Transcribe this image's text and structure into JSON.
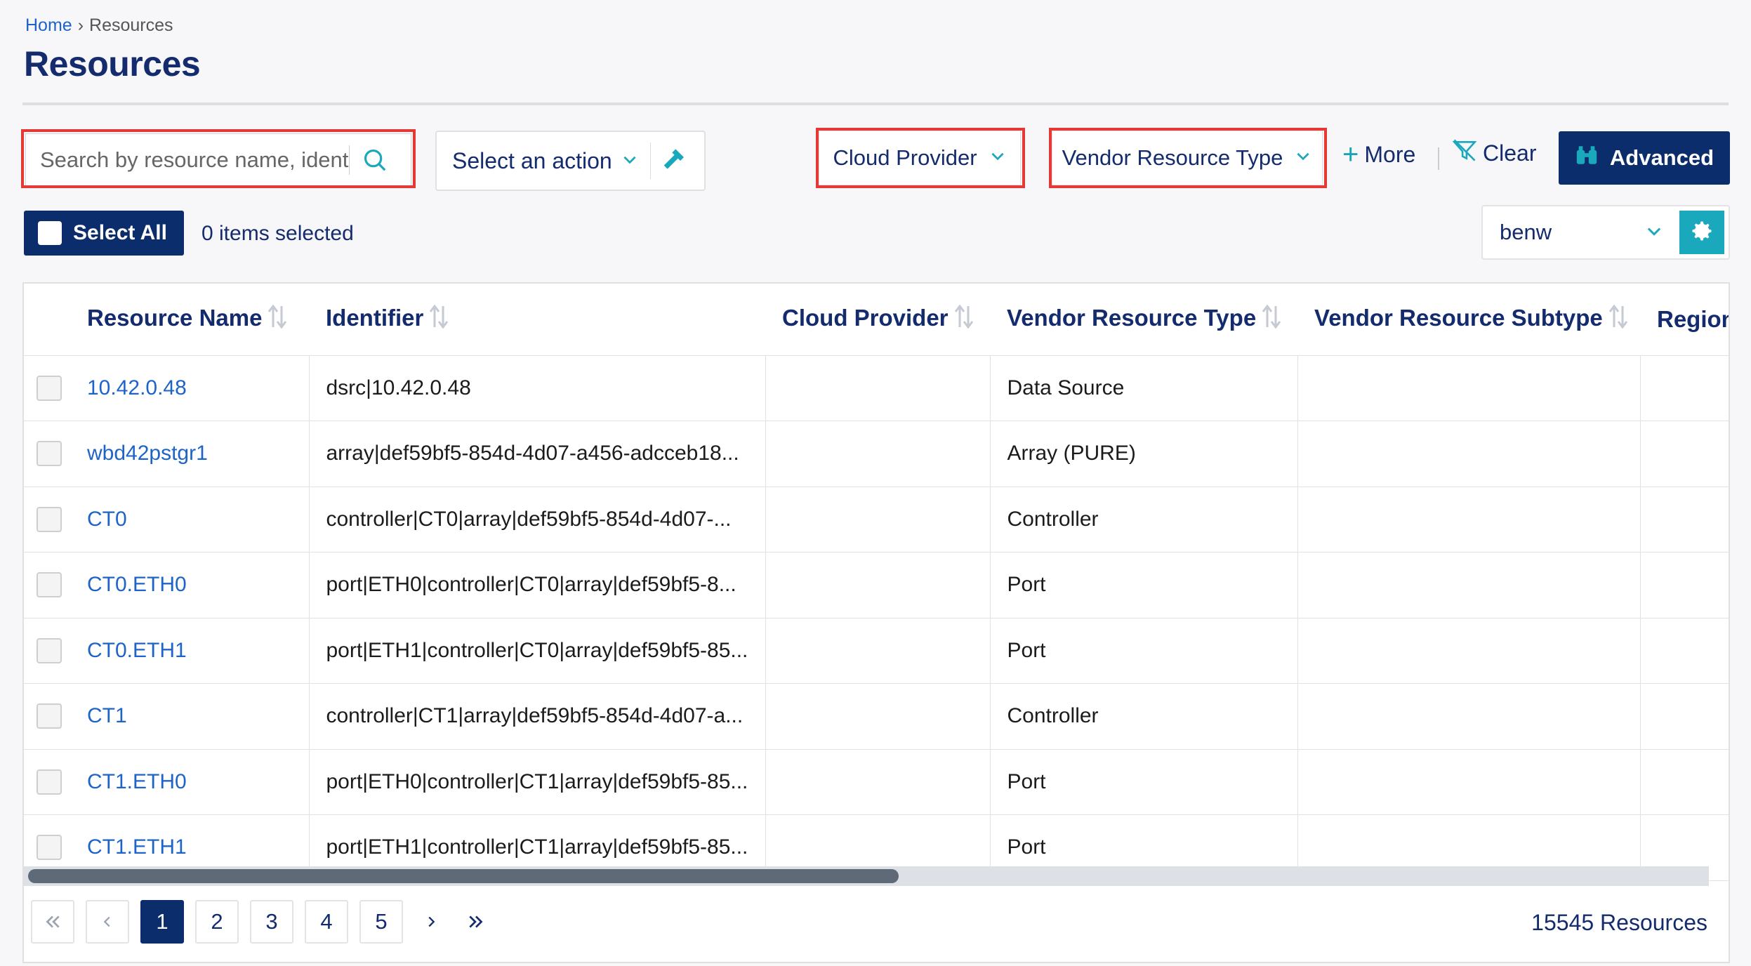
{
  "breadcrumb": {
    "home": "Home",
    "separator": "›",
    "current": "Resources"
  },
  "page": {
    "title": "Resources"
  },
  "toolbar": {
    "search_placeholder": "Search by resource name, identi",
    "action_label": "Select an action",
    "cloud_provider_label": "Cloud Provider",
    "vendor_resource_type_label": "Vendor Resource Type",
    "more_label": "More",
    "clear_label": "Clear",
    "advanced_label": "Advanced",
    "select_all_label": "Select All",
    "items_selected": "0 items selected",
    "user_select_value": "benw"
  },
  "table": {
    "columns": [
      "Resource Name",
      "Identifier",
      "Cloud Provider",
      "Vendor Resource Type",
      "Vendor Resource Subtype",
      "Region"
    ],
    "rows": [
      {
        "name": "10.42.0.48",
        "identifier": "dsrc|10.42.0.48",
        "cloud_provider": "",
        "vendor_type": "Data Source",
        "vendor_subtype": "",
        "region": ""
      },
      {
        "name": "wbd42pstgr1",
        "identifier": "array|def59bf5-854d-4d07-a456-adcceb18...",
        "cloud_provider": "",
        "vendor_type": "Array (PURE)",
        "vendor_subtype": "",
        "region": ""
      },
      {
        "name": "CT0",
        "identifier": "controller|CT0|array|def59bf5-854d-4d07-...",
        "cloud_provider": "",
        "vendor_type": "Controller",
        "vendor_subtype": "",
        "region": ""
      },
      {
        "name": "CT0.ETH0",
        "identifier": "port|ETH0|controller|CT0|array|def59bf5-8...",
        "cloud_provider": "",
        "vendor_type": "Port",
        "vendor_subtype": "",
        "region": ""
      },
      {
        "name": "CT0.ETH1",
        "identifier": "port|ETH1|controller|CT0|array|def59bf5-85...",
        "cloud_provider": "",
        "vendor_type": "Port",
        "vendor_subtype": "",
        "region": ""
      },
      {
        "name": "CT1",
        "identifier": "controller|CT1|array|def59bf5-854d-4d07-a...",
        "cloud_provider": "",
        "vendor_type": "Controller",
        "vendor_subtype": "",
        "region": ""
      },
      {
        "name": "CT1.ETH0",
        "identifier": "port|ETH0|controller|CT1|array|def59bf5-85...",
        "cloud_provider": "",
        "vendor_type": "Port",
        "vendor_subtype": "",
        "region": ""
      },
      {
        "name": "CT1.ETH1",
        "identifier": "port|ETH1|controller|CT1|array|def59bf5-85...",
        "cloud_provider": "",
        "vendor_type": "Port",
        "vendor_subtype": "",
        "region": ""
      }
    ]
  },
  "pagination": {
    "pages": [
      "1",
      "2",
      "3",
      "4",
      "5"
    ],
    "current_page": "1",
    "total": "15545 Resources"
  },
  "icons": {
    "search": "search-icon",
    "chevron": "chevron-down-icon",
    "hammer": "hammer-icon",
    "plus": "plus-icon",
    "clear_filter": "filter-clear-icon",
    "binoculars": "binoculars-icon",
    "gear": "gear-icon",
    "sort": "sort-icon"
  },
  "colors": {
    "navy": "#142c6e",
    "button": "#0c2d6b",
    "teal": "#1aa8bd",
    "link": "#1e64c8",
    "highlight": "#e53935"
  }
}
